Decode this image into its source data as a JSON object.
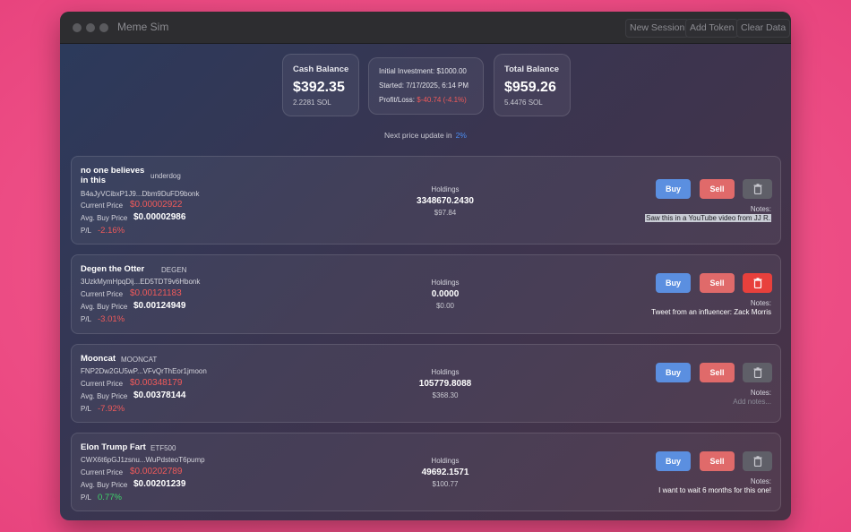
{
  "window": {
    "title": "Meme Sim",
    "toolbar": {
      "new_session": "New Session",
      "add_token": "Add Token",
      "clear_data": "Clear Data"
    }
  },
  "summary": {
    "cash": {
      "label": "Cash Balance",
      "value": "$392.35",
      "sol": "2.2281 SOL"
    },
    "investment": {
      "initial": "Initial Investment: $1000.00",
      "started": "Started: 7/17/2025, 6:14 PM",
      "pl_label": "Profit/Loss:",
      "pl_value": "$-40.74 (-4.1%)"
    },
    "total": {
      "label": "Total Balance",
      "value": "$959.26",
      "sol": "5.4476 SOL"
    }
  },
  "update": {
    "label": "Next price update in",
    "value": "2%"
  },
  "labels": {
    "current_price": "Current Price",
    "avg_buy_price": "Avg. Buy Price",
    "pl": "P/L",
    "holdings": "Holdings",
    "notes": "Notes:",
    "buy": "Buy",
    "sell": "Sell"
  },
  "tokens": [
    {
      "name": "no one believes in this",
      "symbol": "underdog",
      "address": "B4aJyVCibxP1J9...Dbm9DuFD9bonk",
      "current_price": "$0.00002922",
      "avg_buy_price": "$0.00002986",
      "pl": "-2.16%",
      "pl_dir": "neg",
      "holdings": "3348670.2430",
      "holdings_value": "$97.84",
      "note": "Saw this in a YouTube video from JJ R.",
      "note_style": "hl",
      "delete_active": false
    },
    {
      "name": "Degen the Otter",
      "symbol": "DEGEN",
      "address": "3UzkMymHpqDij...ED5TDT9v6Hbonk",
      "current_price": "$0.00121183",
      "avg_buy_price": "$0.00124949",
      "pl": "-3.01%",
      "pl_dir": "neg",
      "holdings": "0.0000",
      "holdings_value": "$0.00",
      "note": "Tweet from an influencer: Zack Morris",
      "note_style": "normal",
      "delete_active": true
    },
    {
      "name": "Mooncat",
      "symbol": "MOONCAT",
      "address": "FNP2Dw2GU5wP...VFvQrThEor1jmoon",
      "current_price": "$0.00348179",
      "avg_buy_price": "$0.00378144",
      "pl": "-7.92%",
      "pl_dir": "neg",
      "holdings": "105779.8088",
      "holdings_value": "$368.30",
      "note": "Add notes...",
      "note_style": "ph",
      "delete_active": false
    },
    {
      "name": "Elon Trump Fart",
      "symbol": "ETF500",
      "address": "CWX6t6pGJ1zsnu...WuPdsteoT6pump",
      "current_price": "$0.00202789",
      "avg_buy_price": "$0.00201239",
      "pl": "0.77%",
      "pl_dir": "pos",
      "holdings": "49692.1571",
      "holdings_value": "$100.77",
      "note": "I want to wait 6 months for this one!",
      "note_style": "normal",
      "delete_active": false
    }
  ]
}
